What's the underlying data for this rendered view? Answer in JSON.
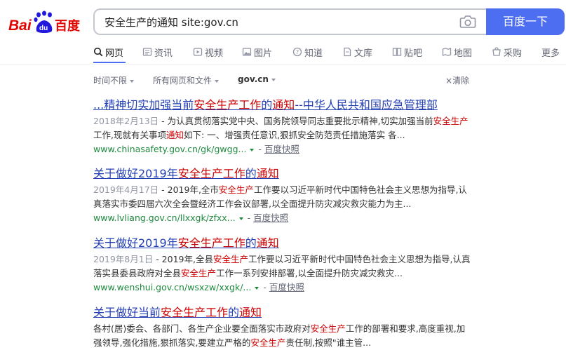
{
  "logo": {
    "text_left": "Bai",
    "text_paw": "du",
    "text_cn": "百度"
  },
  "search": {
    "query": "安全生产的通知 site:gov.cn",
    "button_label": "百度一下"
  },
  "tabs": [
    {
      "label": "网页",
      "icon": "search-icon"
    },
    {
      "label": "资讯",
      "icon": "news-icon"
    },
    {
      "label": "视频",
      "icon": "video-icon"
    },
    {
      "label": "图片",
      "icon": "image-icon"
    },
    {
      "label": "知道",
      "icon": "question-icon"
    },
    {
      "label": "文库",
      "icon": "document-icon"
    },
    {
      "label": "贴吧",
      "icon": "tieba-icon"
    },
    {
      "label": "地图",
      "icon": "map-icon"
    },
    {
      "label": "采购",
      "icon": "purchase-icon"
    },
    {
      "label": "更多",
      "icon": ""
    }
  ],
  "filters": {
    "time": "时间不限",
    "scope": "所有网页和文件",
    "site": "gov.cn",
    "clear": "清除"
  },
  "results": [
    {
      "title": [
        {
          "t": "...精神切实加强当前"
        },
        {
          "t": "安全生产工作",
          "hl": true
        },
        {
          "t": "的"
        },
        {
          "t": "通知",
          "hl": true
        },
        {
          "t": "--中华人民共和国应急管理部"
        }
      ],
      "date": "2018年2月13日",
      "abstract": [
        {
          "t": " - 为认真贯彻落实党中央、国务院领导同志重要批示精神,切实加强当前"
        },
        {
          "t": "安全生产",
          "hl": true
        },
        {
          "t": "工作,现就有关事项"
        },
        {
          "t": "通知",
          "hl": true
        },
        {
          "t": "如下: 一、增强责任意识,狠抓安全防范责任措施落实 各..."
        }
      ],
      "url": "www.chinasafety.gov.cn/gk/gwgg...",
      "snapshot": "百度快照"
    },
    {
      "title": [
        {
          "t": "关于做好2019年"
        },
        {
          "t": "安全生产工作",
          "hl": true
        },
        {
          "t": "的"
        },
        {
          "t": "通知",
          "hl": true
        }
      ],
      "date": "2019年4月17日",
      "abstract": [
        {
          "t": " - 2019年,全市"
        },
        {
          "t": "安全生产",
          "hl": true
        },
        {
          "t": "工作要以习近平新时代中国特色社会主义思想为指导,认真落实市委四届六次全会暨经济工作会议部署,以全面提升防灾减灾救灾能力为主..."
        }
      ],
      "url": "www.lvliang.gov.cn/llxxgk/zfxx...",
      "snapshot": "百度快照"
    },
    {
      "title": [
        {
          "t": "关于做好2019年"
        },
        {
          "t": "安全生产工作",
          "hl": true
        },
        {
          "t": "的"
        },
        {
          "t": "通知",
          "hl": true
        }
      ],
      "date": "2019年8月1日",
      "abstract": [
        {
          "t": " - 2019年,全县"
        },
        {
          "t": "安全生产",
          "hl": true
        },
        {
          "t": "工作要以习近平新时代中国特色社会主义思想为指导,认真落实县委县政府对全县"
        },
        {
          "t": "安全生产",
          "hl": true
        },
        {
          "t": "工作一系列安排部署,以全面提升防灾减灾救灾..."
        }
      ],
      "url": "www.wenshui.gov.cn/wsxzw/xxgk/...",
      "snapshot": "百度快照"
    },
    {
      "title": [
        {
          "t": "关于做好当前"
        },
        {
          "t": "安全生产工作",
          "hl": true
        },
        {
          "t": "的"
        },
        {
          "t": "通知",
          "hl": true
        }
      ],
      "date": "",
      "abstract": [
        {
          "t": "各村(居)委会、各部门、各生产企业要全面落实市政府对"
        },
        {
          "t": "安全生产",
          "hl": true
        },
        {
          "t": "工作的部署和要求,高度重视,加强领导,强化措施,狠抓落实,要建立严格的"
        },
        {
          "t": "安全生产",
          "hl": true
        },
        {
          "t": "责任制,按照\"谁主管..."
        }
      ],
      "url": "",
      "snapshot": ""
    }
  ]
}
